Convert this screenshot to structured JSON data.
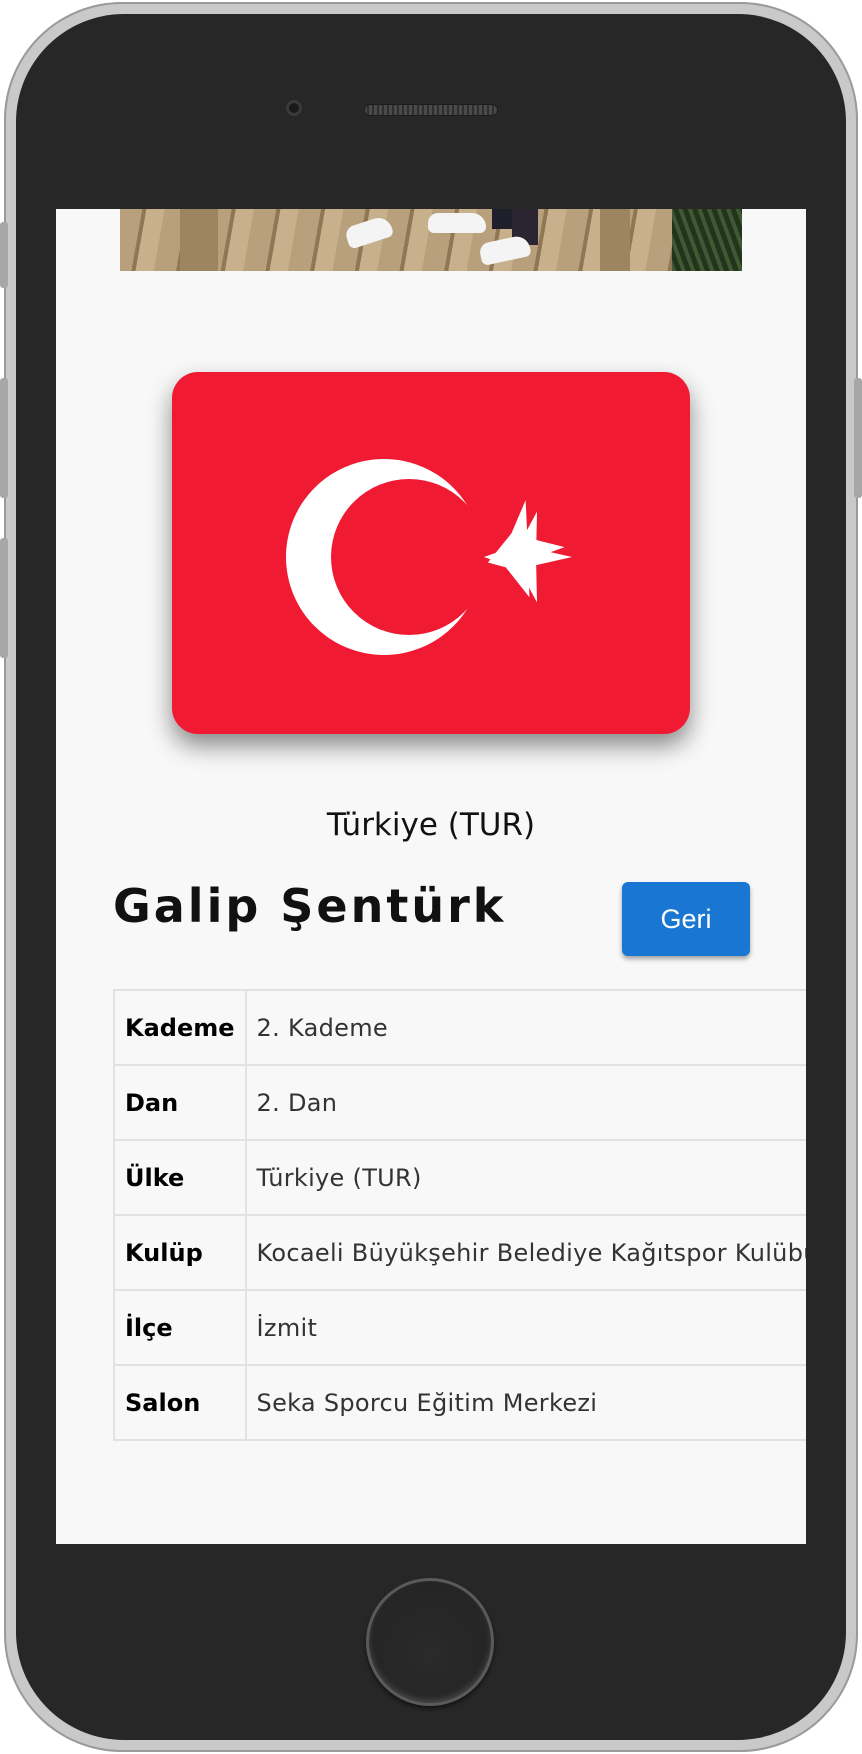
{
  "country": {
    "caption": "Türkiye (TUR)",
    "flag_colors": {
      "field": "#f01a33",
      "emblem": "#ffffff"
    }
  },
  "athlete": {
    "name": "Galip Şentürk"
  },
  "actions": {
    "back_label": "Geri",
    "accent": "#1976d2"
  },
  "details": [
    {
      "label": "Kademe",
      "value": "2. Kademe"
    },
    {
      "label": "Dan",
      "value": "2. Dan"
    },
    {
      "label": "Ülke",
      "value": "Türkiye (TUR)"
    },
    {
      "label": "Kulüp",
      "value": "Kocaeli Büyükşehir Belediye Kağıtspor Kulübü"
    },
    {
      "label": "İlçe",
      "value": "İzmit"
    },
    {
      "label": "Salon",
      "value": "Seka Sporcu Eğitim Merkezi"
    }
  ]
}
